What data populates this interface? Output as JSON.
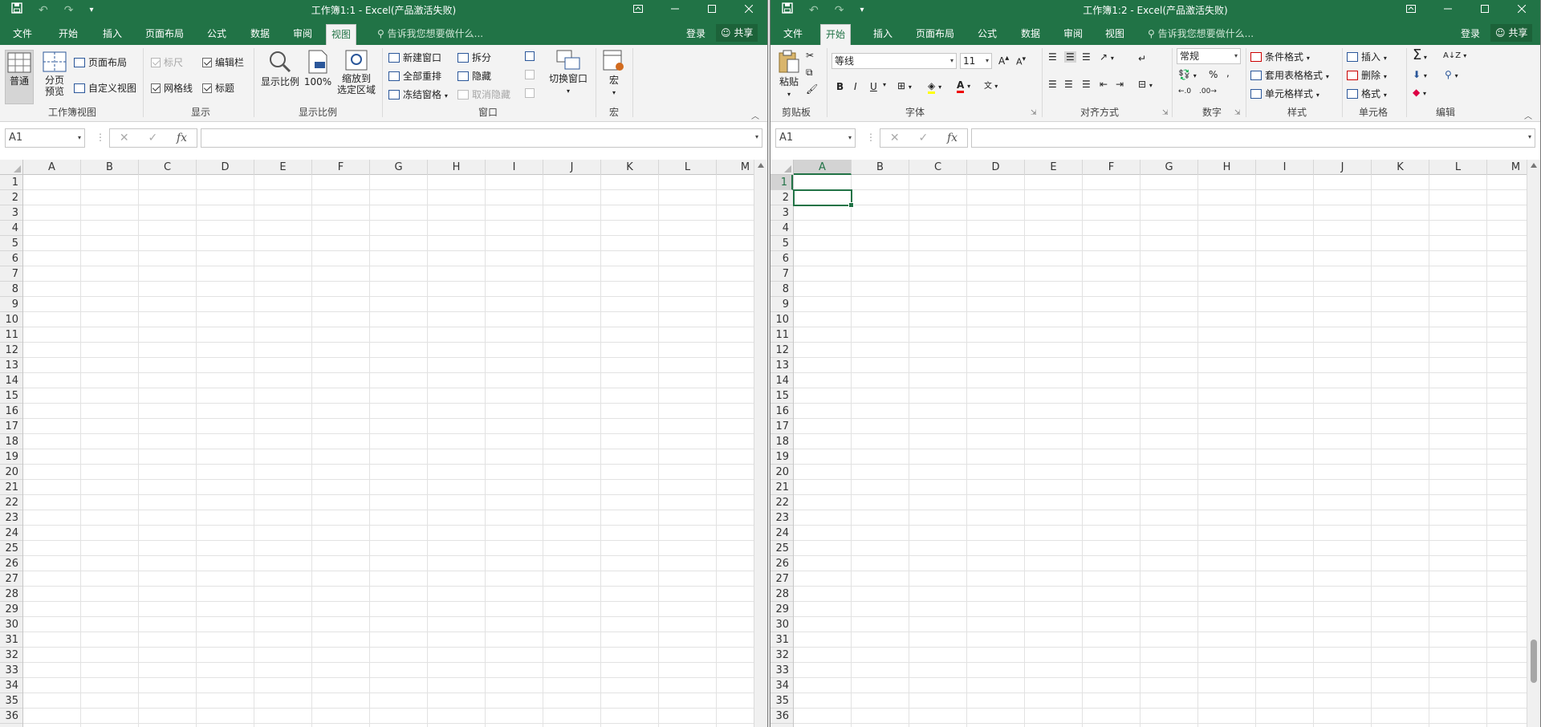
{
  "left": {
    "qat_undo": "↶",
    "qat_redo": "↷",
    "qat_custom": "▾",
    "title": "工作簿1:1 - Excel(产品激活失败)",
    "tabs": [
      "文件",
      "开始",
      "插入",
      "页面布局",
      "公式",
      "数据",
      "审阅",
      "视图"
    ],
    "active_tab": "视图",
    "tell_me": "告诉我您想要做什么...",
    "sign_in": "登录",
    "share": "共享",
    "ribbon": {
      "normal": "普通",
      "page_break_1": "分页",
      "page_break_2": "预览",
      "page_layout": "页面布局",
      "custom_views": "自定义视图",
      "ruler": "标尺",
      "formula_bar": "编辑栏",
      "gridlines": "网格线",
      "headings": "标题",
      "zoom": "显示比例",
      "zoom100": "100%",
      "zoom_sel_1": "缩放到",
      "zoom_sel_2": "选定区域",
      "new_window": "新建窗口",
      "arrange_all": "全部重排",
      "freeze_panes": "冻结窗格",
      "split": "拆分",
      "hide": "隐藏",
      "unhide": "取消隐藏",
      "switch_windows": "切换窗口",
      "macros": "宏",
      "groups": [
        "工作簿视图",
        "显示",
        "显示比例",
        "窗口",
        "宏"
      ]
    },
    "name_box": "A1",
    "columns": [
      "A",
      "B",
      "C",
      "D",
      "E",
      "F",
      "G",
      "H",
      "I",
      "J",
      "K",
      "L",
      "M"
    ],
    "selected_column": null,
    "selected_row": null
  },
  "right": {
    "qat_undo": "↶",
    "qat_redo": "↷",
    "qat_custom": "▾",
    "title": "工作簿1:2 - Excel(产品激活失败)",
    "tabs": [
      "文件",
      "开始",
      "插入",
      "页面布局",
      "公式",
      "数据",
      "审阅",
      "视图"
    ],
    "active_tab": "开始",
    "tell_me": "告诉我您想要做什么...",
    "sign_in": "登录",
    "share": "共享",
    "ribbon": {
      "paste": "粘贴",
      "font_name": "等线",
      "font_size": "11",
      "bold": "B",
      "italic": "I",
      "underline": "U",
      "number_format": "常规",
      "percent": "%",
      "comma": ",",
      "cond_format": "条件格式",
      "table_format": "套用表格格式",
      "cell_styles": "单元格样式",
      "insert": "插入",
      "delete": "删除",
      "format": "格式",
      "sum": "Σ",
      "groups": [
        "剪贴板",
        "字体",
        "对齐方式",
        "数字",
        "样式",
        "单元格",
        "编辑"
      ]
    },
    "name_box": "A1",
    "columns": [
      "A",
      "B",
      "C",
      "D",
      "E",
      "F",
      "G",
      "H",
      "I",
      "J",
      "K",
      "L",
      "M"
    ],
    "selected_column": "A",
    "selected_row": 1
  },
  "rows": [
    1,
    2,
    3,
    4,
    5,
    6,
    7,
    8,
    9,
    10,
    11,
    12,
    13,
    14,
    15,
    16,
    17,
    18,
    19,
    20,
    21,
    22,
    23,
    24,
    25,
    26,
    27,
    28,
    29,
    30,
    31,
    32,
    33,
    34,
    35,
    36
  ]
}
